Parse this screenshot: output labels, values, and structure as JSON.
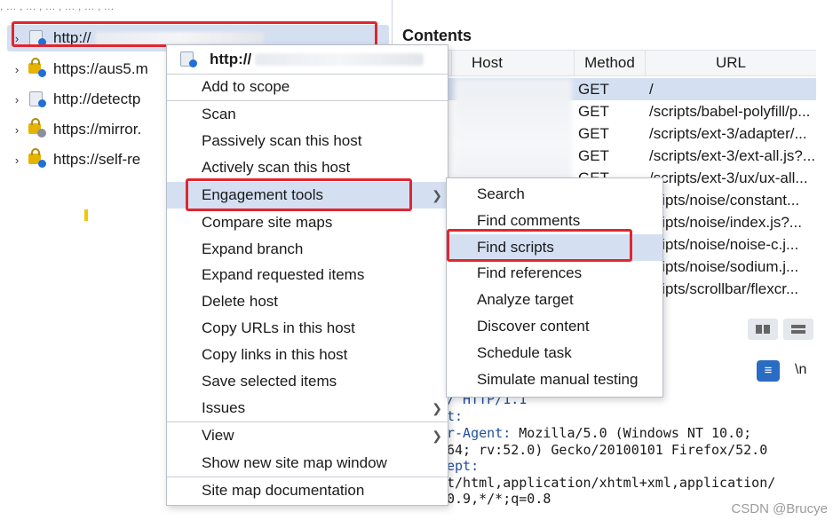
{
  "site_map": {
    "top_fragment": ", … , … , … , … , … , …",
    "nodes": [
      {
        "label": "http://",
        "icon": "page-icon",
        "badge": "blue-dot",
        "selected": true
      },
      {
        "label": "https://aus5.m",
        "icon": "lock-icon",
        "badge": "blue-dot",
        "selected": false
      },
      {
        "label": "http://detectp",
        "icon": "page-icon",
        "badge": "blue-dot",
        "selected": false
      },
      {
        "label": "https://mirror.",
        "icon": "lock-icon",
        "badge": "gear",
        "selected": false
      },
      {
        "label": "https://self-re",
        "icon": "lock-icon",
        "badge": "blue-dot",
        "selected": false
      }
    ]
  },
  "contents": {
    "title": "Contents",
    "columns": [
      "Host",
      "Method",
      "URL"
    ],
    "rows": [
      {
        "method": "GET",
        "url": "/"
      },
      {
        "method": "GET",
        "url": "/scripts/babel-polyfill/p..."
      },
      {
        "method": "GET",
        "url": "/scripts/ext-3/adapter/..."
      },
      {
        "method": "GET",
        "url": "/scripts/ext-3/ext-all.js?..."
      },
      {
        "method": "GET",
        "url": "/scripts/ext-3/ux/ux-all..."
      },
      {
        "method": "",
        "url": "cripts/noise/constant..."
      },
      {
        "method": "",
        "url": "cripts/noise/index.js?..."
      },
      {
        "method": "",
        "url": "cripts/noise/noise-c.j..."
      },
      {
        "method": "",
        "url": "cripts/noise/sodium.j..."
      },
      {
        "method": "",
        "url": "cripts/scrollbar/flexcr..."
      }
    ]
  },
  "request": {
    "newline_label": "\\n",
    "lines": [
      {
        "key": "/ HTTP/1.1",
        "value": ""
      },
      {
        "key": "t:",
        "value": ""
      },
      {
        "key": "r-Agent:",
        "value": " Mozilla/5.0 (Windows NT 10.0;"
      },
      {
        "key": "64; rv:52.0) Gecko/20100101 Firefox/52.0",
        "value": ""
      },
      {
        "key": "ept:",
        "value": ""
      },
      {
        "key": "t/html,application/xhtml+xml,application/",
        "value": ""
      },
      {
        "key": "0.9,*/*;q=0.8",
        "value": ""
      }
    ]
  },
  "context_menu": {
    "header": "http://",
    "items": [
      {
        "label": "Add to scope"
      },
      {
        "label": "Scan"
      },
      {
        "label": "Passively scan this host"
      },
      {
        "label": "Actively scan this host"
      },
      {
        "label": "Engagement tools",
        "submenu": true
      },
      {
        "label": "Compare site maps"
      },
      {
        "label": "Expand branch"
      },
      {
        "label": "Expand requested items"
      },
      {
        "label": "Delete host"
      },
      {
        "label": "Copy URLs in this host"
      },
      {
        "label": "Copy links in this host"
      },
      {
        "label": "Save selected items"
      },
      {
        "label": "Issues",
        "submenu": true
      },
      {
        "label": "View",
        "submenu": true
      },
      {
        "label": "Show new site map window"
      },
      {
        "label": "Site map documentation"
      }
    ]
  },
  "engagement_submenu": {
    "items": [
      {
        "label": "Search"
      },
      {
        "label": "Find comments"
      },
      {
        "label": "Find scripts"
      },
      {
        "label": "Find references"
      },
      {
        "label": "Analyze target"
      },
      {
        "label": "Discover content"
      },
      {
        "label": "Schedule task"
      },
      {
        "label": "Simulate manual testing"
      }
    ]
  },
  "watermark": "CSDN @Brucye",
  "colors": {
    "highlight": "#d4e0f2",
    "annotation_red": "#e0262e",
    "accent_blue": "#1f6fd6"
  }
}
